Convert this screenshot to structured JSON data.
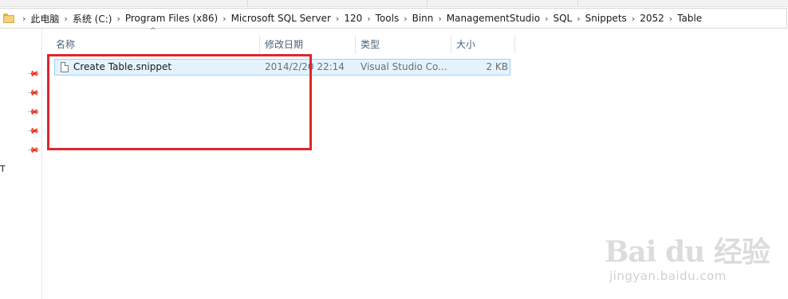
{
  "breadcrumb": [
    "此电脑",
    "系统 (C:)",
    "Program Files (x86)",
    "Microsoft SQL Server",
    "120",
    "Tools",
    "Binn",
    "ManagementStudio",
    "SQL",
    "Snippets",
    "2052",
    "Table"
  ],
  "columns": {
    "name": "名称",
    "modified": "修改日期",
    "type": "类型",
    "size": "大小"
  },
  "files": [
    {
      "name": "Create Table.snippet",
      "modified": "2014/2/20 22:14",
      "type": "Visual Studio Co...",
      "size": "2 KB"
    }
  ],
  "nav": {
    "left_glyph": "T"
  },
  "watermark": {
    "logo": "Bai  du 经验",
    "url": "jingyan.baidu.com"
  },
  "colors": {
    "highlight": "#e0262c",
    "selection_bg": "#e5f3ff",
    "selection_border": "#99d1ff"
  }
}
